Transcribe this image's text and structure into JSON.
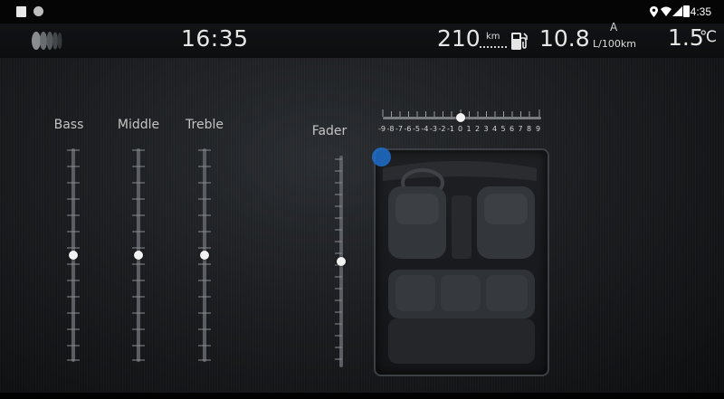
{
  "status_bar": {
    "time": "4:35"
  },
  "info_bar": {
    "clock": "16:35",
    "range_value": "210",
    "range_unit": "km",
    "consumption_value": "10.8",
    "consumption_mode": "A",
    "consumption_unit": "L/100km",
    "temperature_value": "1.5",
    "temperature_unit": "℃"
  },
  "equalizer": {
    "bass": {
      "label": "Bass",
      "level": 0.5
    },
    "middle": {
      "label": "Middle",
      "level": 0.5
    },
    "treble": {
      "label": "Treble",
      "level": 0.5
    }
  },
  "fader": {
    "label": "Fader",
    "level": 0.5
  },
  "balance": {
    "scale": [
      "-9",
      "-8",
      "-7",
      "-6",
      "-5",
      "-4",
      "-3",
      "-2",
      "-1",
      "0",
      "1",
      "2",
      "3",
      "4",
      "5",
      "6",
      "7",
      "8",
      "9"
    ],
    "value": 0
  },
  "colors": {
    "accent": "#1e6fcc",
    "knob": "#f2f2f2",
    "track": "#5a5d61"
  },
  "icons": {
    "logo": "tire-logo-icon",
    "fuel": "fuel-pump-icon"
  }
}
